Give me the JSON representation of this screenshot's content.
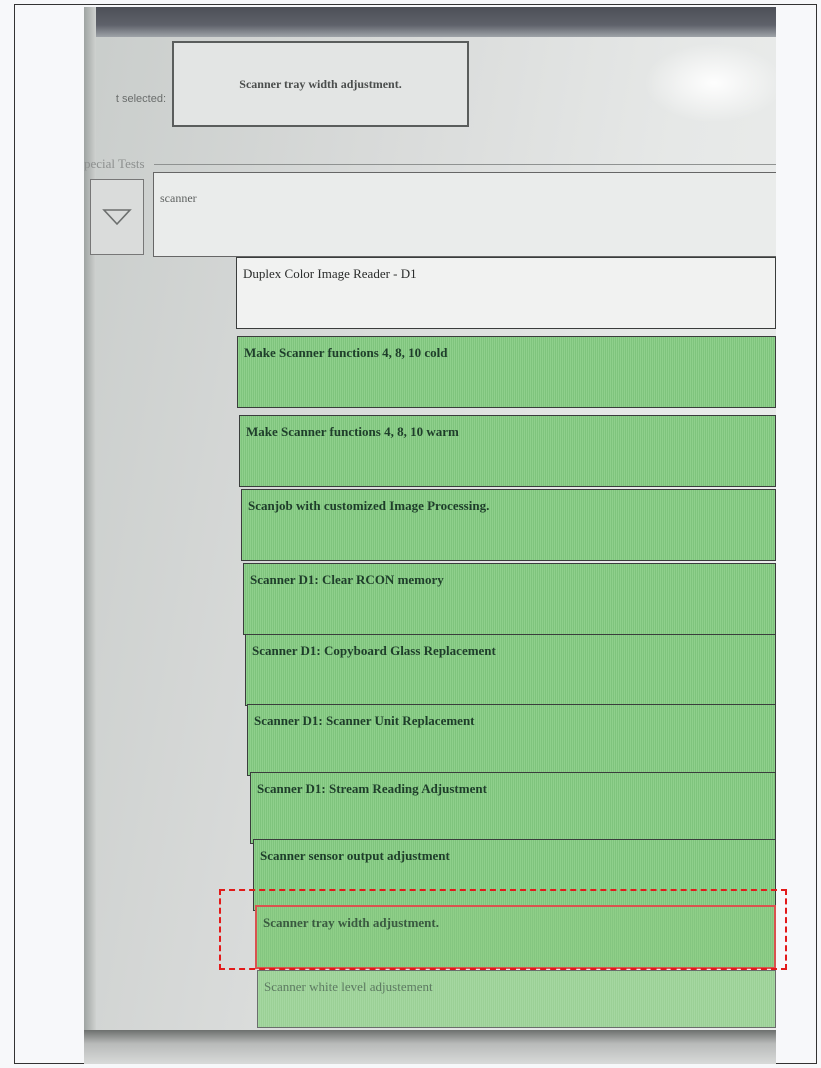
{
  "header": {
    "selected_label": "t selected:",
    "selected_value": "Scanner tray width adjustment."
  },
  "special_tests": {
    "section_label": "pecial Tests",
    "search_value": "scanner"
  },
  "list": {
    "items": [
      {
        "label": "Duplex Color Image Reader - D1"
      },
      {
        "label": "Make Scanner functions 4, 8, 10 cold"
      },
      {
        "label": "Make Scanner functions 4, 8, 10 warm"
      },
      {
        "label": "Scanjob with customized Image Processing."
      },
      {
        "label": "Scanner D1: Clear RCON memory"
      },
      {
        "label": "Scanner D1: Copyboard Glass Replacement"
      },
      {
        "label": "Scanner D1: Scanner Unit Replacement"
      },
      {
        "label": "Scanner D1: Stream Reading Adjustment"
      },
      {
        "label": "Scanner sensor output adjustment"
      },
      {
        "label": "Scanner tray width adjustment."
      },
      {
        "label": "Scanner white level adjustement"
      }
    ]
  },
  "colors": {
    "item_green": "#8fd08c",
    "highlight_red": "#e21a1a",
    "selected_border": "#d9534f"
  },
  "icons": {
    "dropdown": "chevron-down-icon"
  }
}
